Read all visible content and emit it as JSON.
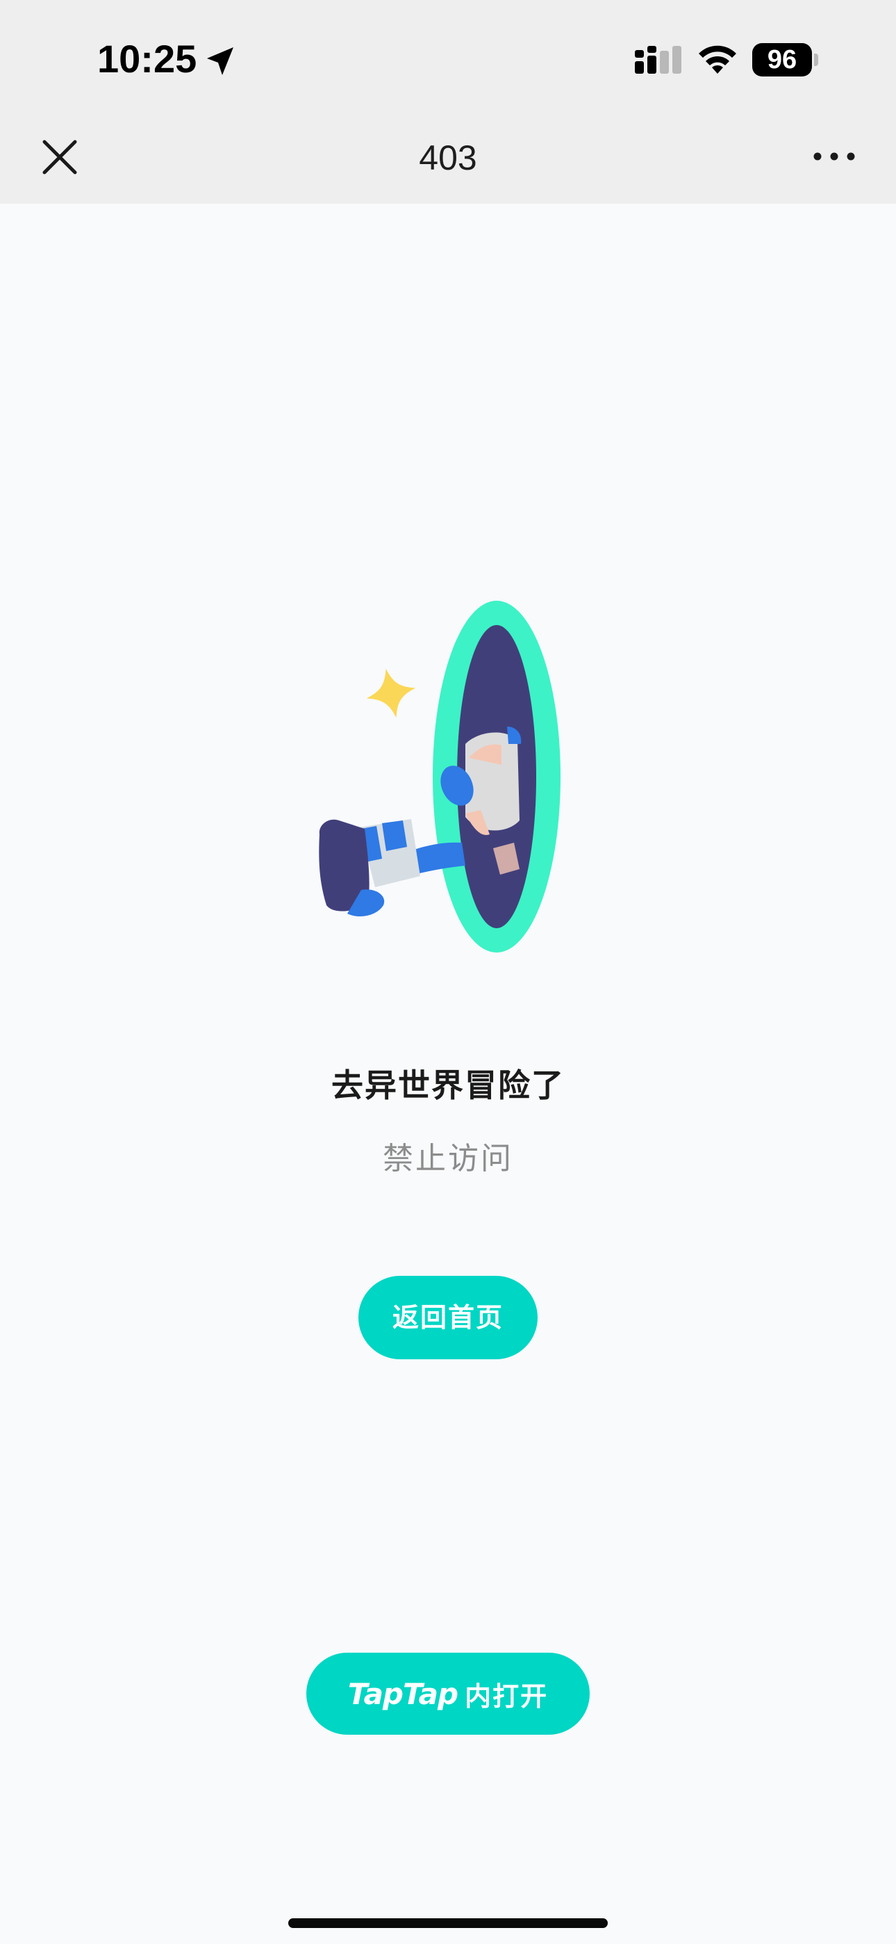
{
  "status_bar": {
    "time": "10:25",
    "battery": "96",
    "icons": [
      "location-arrow-icon",
      "cellular-signal-icon",
      "wifi-icon",
      "battery-icon"
    ]
  },
  "nav": {
    "title": "403",
    "close_icon": "close-icon",
    "more_icon": "more-icon"
  },
  "content": {
    "headline": "去异世界冒险了",
    "subtext": "禁止访问",
    "home_button": "返回首页"
  },
  "open_app": {
    "brand": "TapTap",
    "label": "内打开"
  },
  "colors": {
    "accent": "#00d6c4",
    "background": "#f8fafc",
    "header_bg": "#eeeeee",
    "portal_ring": "#3df2c6",
    "portal_inner": "#413f7a",
    "sparkle": "#fbd757"
  }
}
